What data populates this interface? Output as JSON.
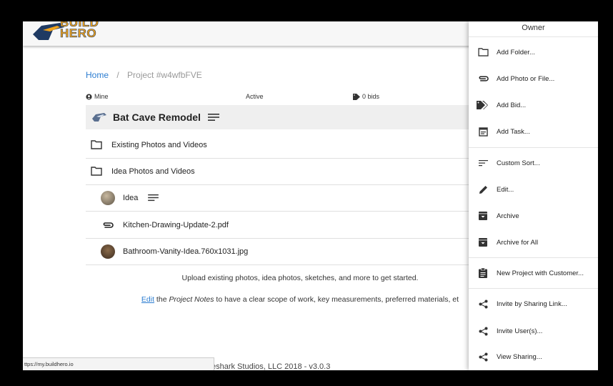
{
  "header": {
    "logo_line1": "BUILD",
    "logo_line2": "HERO"
  },
  "breadcrumb": {
    "home": "Home",
    "separator": "/",
    "current": "Project #w4wfbFVE"
  },
  "meta": {
    "owner": "Mine",
    "status": "Active",
    "bids": "0 bids"
  },
  "project": {
    "title": "Bat Cave Remodel"
  },
  "rows": [
    {
      "label": "Existing Photos and Videos",
      "icon": "folder-icon"
    },
    {
      "label": "Idea Photos and Videos",
      "icon": "folder-icon"
    },
    {
      "label": "Idea",
      "icon": "avatar"
    },
    {
      "label": "Kitchen-Drawing-Update-2.pdf",
      "icon": "attachment-icon"
    },
    {
      "label": "Bathroom-Vanity-Idea.760x1031.jpg",
      "icon": "image-thumbnail"
    }
  ],
  "info": {
    "upload_text": "Upload existing photos, idea photos, sketches, and more to get started.",
    "edit_link": "Edit",
    "edit_the": " the ",
    "project_notes": "Project Notes",
    "edit_rest": " to have a clear scope of work, key measurements, preferred materials, et"
  },
  "footer": {
    "text": "© Fireshark Studios, LLC 2018 - v3.0.3"
  },
  "statusbar": {
    "url": "ttps://my.buildhero.io"
  },
  "menu": {
    "header": "Owner",
    "items": [
      {
        "label": "Add Folder...",
        "icon": "folder-icon"
      },
      {
        "label": "Add Photo or File...",
        "icon": "attachment-icon"
      },
      {
        "label": "Add Bid...",
        "icon": "tags-icon"
      },
      {
        "label": "Add Task...",
        "icon": "task-icon"
      },
      {
        "label": "Custom Sort...",
        "icon": "sort-icon"
      },
      {
        "label": "Edit...",
        "icon": "pencil-icon"
      },
      {
        "label": "Archive",
        "icon": "archive-icon"
      },
      {
        "label": "Archive for All",
        "icon": "archive-icon"
      },
      {
        "label": "New Project with Customer...",
        "icon": "clipboard-icon"
      },
      {
        "label": "Invite by Sharing Link...",
        "icon": "share-icon"
      },
      {
        "label": "Invite User(s)...",
        "icon": "share-icon"
      },
      {
        "label": "View Sharing...",
        "icon": "share-icon"
      }
    ]
  }
}
